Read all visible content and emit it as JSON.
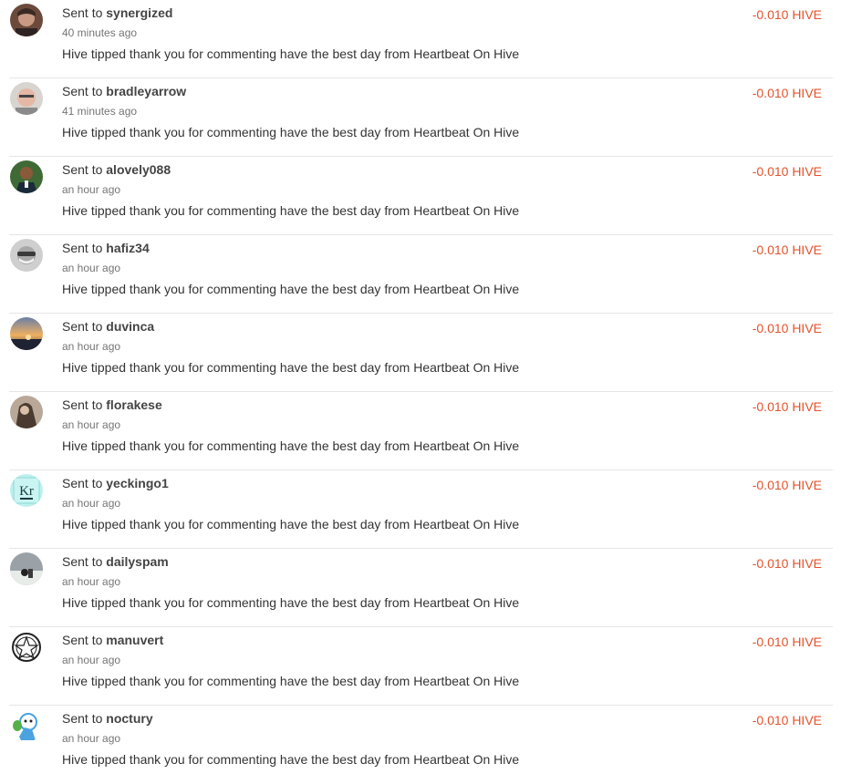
{
  "transactions": [
    {
      "prefix": "Sent to",
      "user": "synergized",
      "time": "40 minutes ago",
      "memo": "Hive tipped thank you for commenting have the best day from Heartbeat On Hive",
      "amount": "-0.010 HIVE"
    },
    {
      "prefix": "Sent to",
      "user": "bradleyarrow",
      "time": "41 minutes ago",
      "memo": "Hive tipped thank you for commenting have the best day from Heartbeat On Hive",
      "amount": "-0.010 HIVE"
    },
    {
      "prefix": "Sent to",
      "user": "alovely088",
      "time": "an hour ago",
      "memo": "Hive tipped thank you for commenting have the best day from Heartbeat On Hive",
      "amount": "-0.010 HIVE"
    },
    {
      "prefix": "Sent to",
      "user": "hafiz34",
      "time": "an hour ago",
      "memo": "Hive tipped thank you for commenting have the best day from Heartbeat On Hive",
      "amount": "-0.010 HIVE"
    },
    {
      "prefix": "Sent to",
      "user": "duvinca",
      "time": "an hour ago",
      "memo": "Hive tipped thank you for commenting have the best day from Heartbeat On Hive",
      "amount": "-0.010 HIVE"
    },
    {
      "prefix": "Sent to",
      "user": "florakese",
      "time": "an hour ago",
      "memo": "Hive tipped thank you for commenting have the best day from Heartbeat On Hive",
      "amount": "-0.010 HIVE"
    },
    {
      "prefix": "Sent to",
      "user": "yeckingo1",
      "time": "an hour ago",
      "memo": "Hive tipped thank you for commenting have the best day from Heartbeat On Hive",
      "amount": "-0.010 HIVE",
      "avatar_text": "Kr"
    },
    {
      "prefix": "Sent to",
      "user": "dailyspam",
      "time": "an hour ago",
      "memo": "Hive tipped thank you for commenting have the best day from Heartbeat On Hive",
      "amount": "-0.010 HIVE"
    },
    {
      "prefix": "Sent to",
      "user": "manuvert",
      "time": "an hour ago",
      "memo": "Hive tipped thank you for commenting have the best day from Heartbeat On Hive",
      "amount": "-0.010 HIVE"
    },
    {
      "prefix": "Sent to",
      "user": "noctury",
      "time": "an hour ago",
      "memo": "Hive tipped thank you for commenting have the best day from Heartbeat On Hive",
      "amount": "-0.010 HIVE"
    }
  ],
  "colors": {
    "amount": "#e6522c",
    "divider": "#e6e6e6",
    "time": "#757575"
  }
}
